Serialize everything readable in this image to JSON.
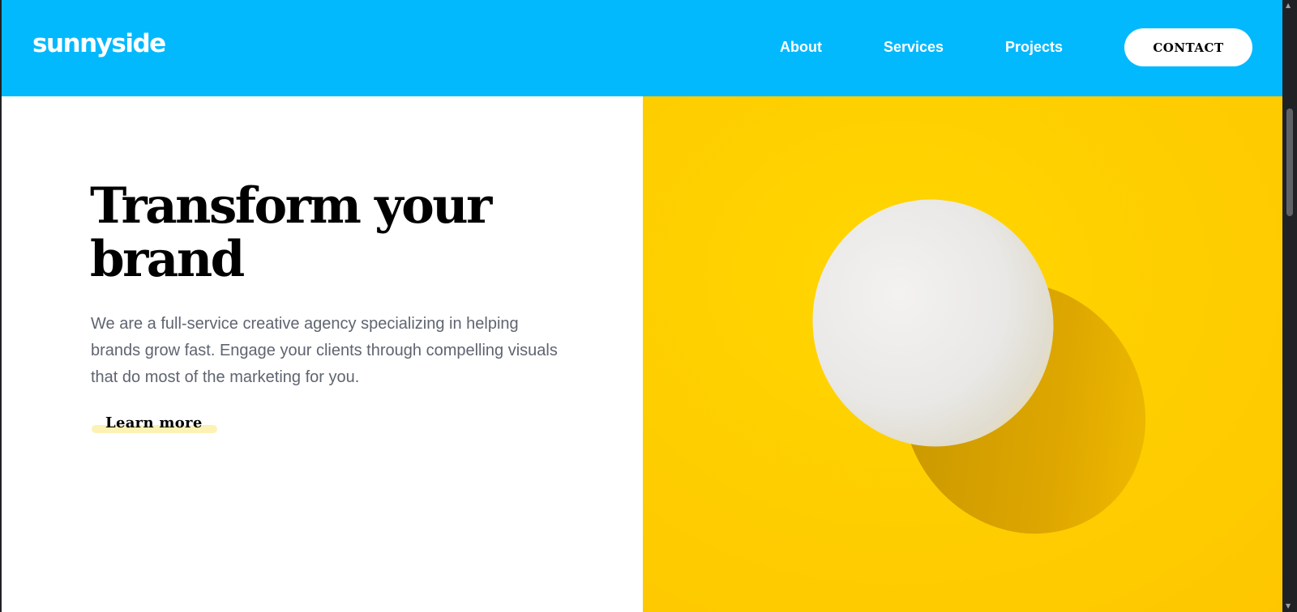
{
  "header": {
    "logo": "sunnyside",
    "nav": [
      {
        "label": "About"
      },
      {
        "label": "Services"
      },
      {
        "label": "Projects"
      }
    ],
    "contact_label": "CONTACT"
  },
  "hero": {
    "title": "Transform your brand",
    "description": "We are a full-service creative agency specializing in helping brands grow fast. Engage your clients through compelling visuals that do most of the marketing for you.",
    "cta_label": "Learn more",
    "image_subject": "white egg on yellow background"
  },
  "colors": {
    "header_bg": "#02b9fe",
    "image_bg": "#ffd300",
    "cta_highlight": "#fdf2b4",
    "body_text": "#5f6470"
  }
}
